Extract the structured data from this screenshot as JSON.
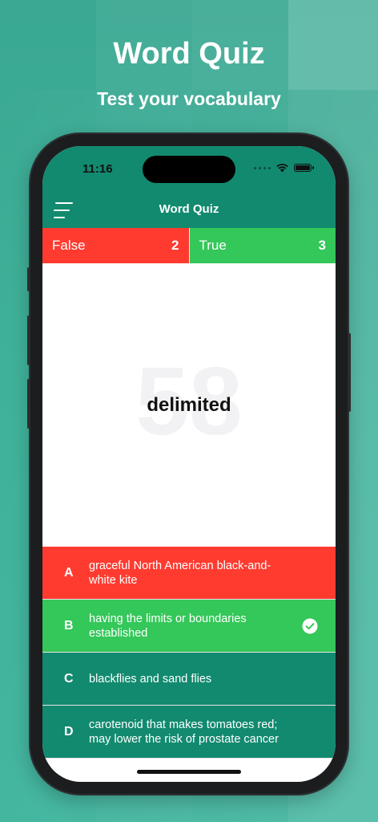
{
  "promo": {
    "title": "Word Quiz",
    "subtitle": "Test your vocabulary"
  },
  "status_bar": {
    "time": "11:16",
    "icons": [
      "cellular-dots-icon",
      "wifi-icon",
      "battery-icon"
    ]
  },
  "nav": {
    "title": "Word Quiz",
    "menu_icon": "menu-icon"
  },
  "score": {
    "false_label": "False",
    "false_count": "2",
    "true_label": "True",
    "true_count": "3"
  },
  "question": {
    "number": "58",
    "word": "delimited"
  },
  "answers": [
    {
      "letter": "A",
      "text": "graceful North American black-and-white kite",
      "state": "wrong"
    },
    {
      "letter": "B",
      "text": "having the limits or boundaries established",
      "state": "correct"
    },
    {
      "letter": "C",
      "text": "blackflies and sand flies",
      "state": "neutral"
    },
    {
      "letter": "D",
      "text": "carotenoid that makes tomatoes red; may lower the risk of prostate cancer",
      "state": "neutral"
    }
  ],
  "colors": {
    "background": "#3fae97",
    "app_bar": "#128a6f",
    "wrong": "#ff3b30",
    "correct": "#34c759",
    "neutral_answer": "#128a6f"
  }
}
